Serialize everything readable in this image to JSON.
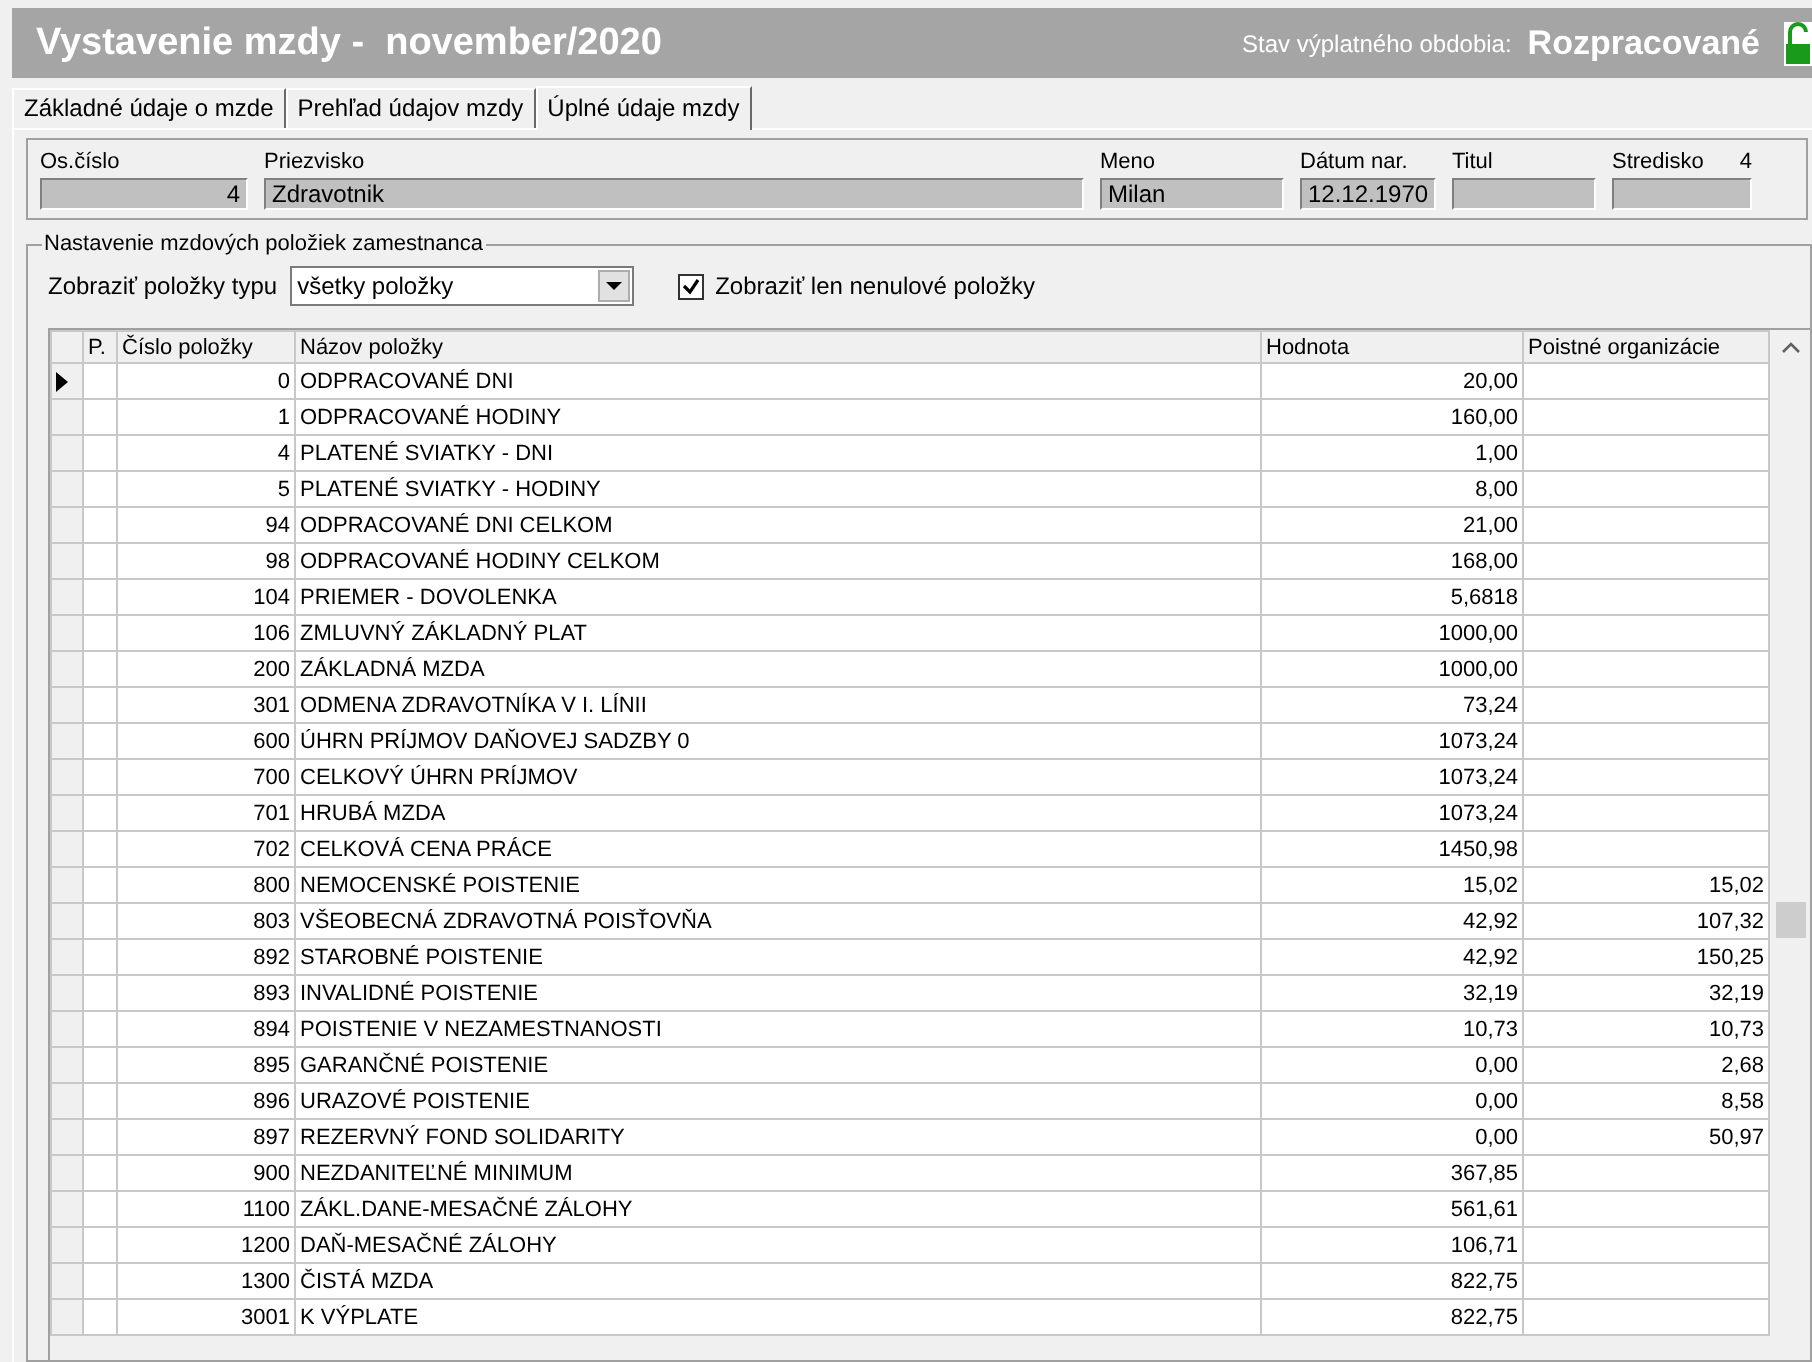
{
  "header": {
    "title": "Vystavenie mzdy -  november/2020",
    "status_label": "Stav výplatného obdobia:",
    "status_value": "Rozpracované",
    "locked": false
  },
  "tabs": [
    {
      "label": "Základné údaje o mzde",
      "selected": false
    },
    {
      "label": "Prehľad údajov mzdy",
      "selected": false
    },
    {
      "label": "Úplné údaje mzdy",
      "selected": true
    }
  ],
  "employee": {
    "fields": [
      {
        "label": "Os.číslo",
        "value": "4"
      },
      {
        "label": "Priezvisko",
        "value": "Zdravotnik"
      },
      {
        "label": "Meno",
        "value": "Milan"
      },
      {
        "label": "Dátum nar.",
        "value": "12.12.1970"
      },
      {
        "label": "Titul"
      },
      {
        "label": "Stredisko",
        "extra": "4"
      }
    ]
  },
  "settings": {
    "title": "Nastavenie mzdových položiek zamestnanca",
    "filter_label": "Zobraziť položky typu",
    "filter_value": "všetky položky",
    "nonzero_label": "Zobraziť len nenulové položky",
    "nonzero_checked": true
  },
  "table": {
    "columns": [
      "P.",
      "Číslo položky",
      "Názov položky",
      "Hodnota",
      "Poistné organizácie"
    ],
    "rows": [
      {
        "selected": true,
        "number": "0",
        "name": "ODPRACOVANÉ DNI",
        "value": "20,00",
        "org": ""
      },
      {
        "selected": false,
        "number": "1",
        "name": "ODPRACOVANÉ HODINY",
        "value": "160,00",
        "org": ""
      },
      {
        "selected": false,
        "number": "4",
        "name": "PLATENÉ SVIATKY - DNI",
        "value": "1,00",
        "org": ""
      },
      {
        "selected": false,
        "number": "5",
        "name": "PLATENÉ SVIATKY - HODINY",
        "value": "8,00",
        "org": ""
      },
      {
        "selected": false,
        "number": "94",
        "name": "ODPRACOVANÉ DNI CELKOM",
        "value": "21,00",
        "org": ""
      },
      {
        "selected": false,
        "number": "98",
        "name": "ODPRACOVANÉ HODINY CELKOM",
        "value": "168,00",
        "org": ""
      },
      {
        "selected": false,
        "number": "104",
        "name": "PRIEMER - DOVOLENKA",
        "value": "5,6818",
        "org": ""
      },
      {
        "selected": false,
        "number": "106",
        "name": "ZMLUVNÝ ZÁKLADNÝ PLAT",
        "value": "1000,00",
        "org": ""
      },
      {
        "selected": false,
        "number": "200",
        "name": "ZÁKLADNÁ MZDA",
        "value": "1000,00",
        "org": ""
      },
      {
        "selected": false,
        "number": "301",
        "name": "ODMENA ZDRAVOTNÍKA V I. LÍNII",
        "value": "73,24",
        "org": ""
      },
      {
        "selected": false,
        "number": "600",
        "name": "ÚHRN PRÍJMOV DAŇOVEJ SADZBY 0",
        "value": "1073,24",
        "org": ""
      },
      {
        "selected": false,
        "number": "700",
        "name": "CELKOVÝ ÚHRN PRÍJMOV",
        "value": "1073,24",
        "org": ""
      },
      {
        "selected": false,
        "number": "701",
        "name": "HRUBÁ MZDA",
        "value": "1073,24",
        "org": ""
      },
      {
        "selected": false,
        "number": "702",
        "name": "CELKOVÁ CENA PRÁCE",
        "value": "1450,98",
        "org": ""
      },
      {
        "selected": false,
        "number": "800",
        "name": "NEMOCENSKÉ POISTENIE",
        "value": "15,02",
        "org": "15,02"
      },
      {
        "selected": false,
        "number": "803",
        "name": "VŠEOBECNÁ ZDRAVOTNÁ POISŤOVŇA",
        "value": "42,92",
        "org": "107,32"
      },
      {
        "selected": false,
        "number": "892",
        "name": "STAROBNÉ POISTENIE",
        "value": "42,92",
        "org": "150,25"
      },
      {
        "selected": false,
        "number": "893",
        "name": "INVALIDNÉ POISTENIE",
        "value": "32,19",
        "org": "32,19"
      },
      {
        "selected": false,
        "number": "894",
        "name": "POISTENIE V NEZAMESTNANOSTI",
        "value": "10,73",
        "org": "10,73"
      },
      {
        "selected": false,
        "number": "895",
        "name": "GARANČNÉ POISTENIE",
        "value": "0,00",
        "org": "2,68"
      },
      {
        "selected": false,
        "number": "896",
        "name": "URAZOVÉ POISTENIE",
        "value": "0,00",
        "org": "8,58"
      },
      {
        "selected": false,
        "number": "897",
        "name": "REZERVNÝ FOND SOLIDARITY",
        "value": "0,00",
        "org": "50,97"
      },
      {
        "selected": false,
        "number": "900",
        "name": "NEZDANITEĽNÉ MINIMUM",
        "value": "367,85",
        "org": ""
      },
      {
        "selected": false,
        "number": "1100",
        "name": "ZÁKL.DANE-MESAČNÉ ZÁLOHY",
        "value": "561,61",
        "org": ""
      },
      {
        "selected": false,
        "number": "1200",
        "name": "DAŇ-MESAČNÉ ZÁLOHY",
        "value": "106,71",
        "org": ""
      },
      {
        "selected": false,
        "number": "1300",
        "name": "ČISTÁ MZDA",
        "value": "822,75",
        "org": ""
      },
      {
        "selected": false,
        "number": "3001",
        "name": "K VÝPLATE",
        "value": "822,75",
        "org": ""
      }
    ]
  }
}
